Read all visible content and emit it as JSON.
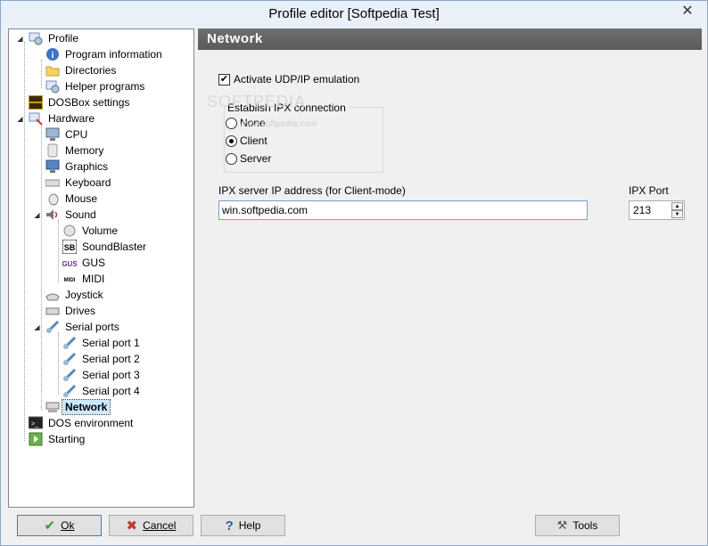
{
  "window": {
    "title": "Profile editor [Softpedia Test]"
  },
  "tree": {
    "profile": "Profile",
    "program_information": "Program information",
    "directories": "Directories",
    "helper_programs": "Helper programs",
    "dosbox_settings": "DOSBox settings",
    "hardware": "Hardware",
    "cpu": "CPU",
    "memory": "Memory",
    "graphics": "Graphics",
    "keyboard": "Keyboard",
    "mouse": "Mouse",
    "sound": "Sound",
    "volume": "Volume",
    "soundblaster": "SoundBlaster",
    "gus": "GUS",
    "midi": "MIDI",
    "joystick": "Joystick",
    "drives": "Drives",
    "serial_ports": "Serial ports",
    "serial_port_1": "Serial port 1",
    "serial_port_2": "Serial port 2",
    "serial_port_3": "Serial port 3",
    "serial_port_4": "Serial port 4",
    "network": "Network",
    "dos_environment": "DOS environment",
    "starting": "Starting"
  },
  "network_page": {
    "header": "Network",
    "activate_label": "Activate UDP/IP emulation",
    "activate_checked": true,
    "ipx_group_label": "Establish IPX connection",
    "options": [
      "None",
      "Client",
      "Server"
    ],
    "selected_option": "Client",
    "ip_label": "IPX server IP address (for Client-mode)",
    "ip_value": "win.softpedia.com",
    "port_label": "IPX Port",
    "port_value": "213"
  },
  "buttons": {
    "ok": "Ok",
    "cancel": "Cancel",
    "help": "Help",
    "tools": "Tools"
  },
  "watermark": {
    "main": "SOFTPEDIA",
    "sub": "www.softpedia.com"
  }
}
